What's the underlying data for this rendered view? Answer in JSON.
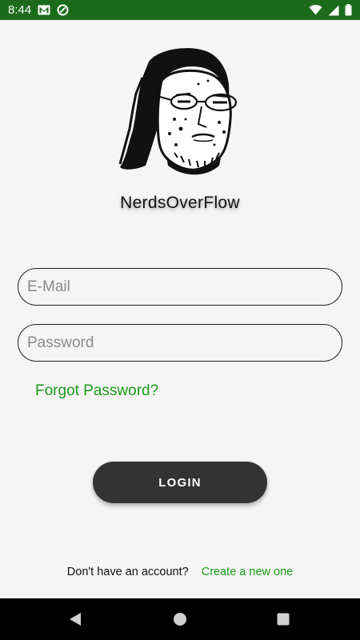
{
  "status_bar": {
    "time": "8:44",
    "icons": [
      "gmail-icon",
      "data-saver-icon",
      "wifi-icon",
      "signal-icon",
      "battery-icon"
    ]
  },
  "app": {
    "name": "NerdsOverFlow",
    "logo_icon": "nerd-face-logo"
  },
  "form": {
    "email_placeholder": "E-Mail",
    "email_value": "",
    "password_placeholder": "Password",
    "password_value": "",
    "forgot_label": "Forgot Password?",
    "login_label": "LOGIN"
  },
  "signup": {
    "prompt": "Don't have an account?",
    "link": "Create a new one"
  },
  "colors": {
    "status_bar": "#1b6b1b",
    "accent_green": "#1a9a1a",
    "button_bg": "#333333",
    "background": "#f5f5f5"
  },
  "nav_bar": {
    "icons": [
      "back-icon",
      "home-icon",
      "recents-icon"
    ]
  }
}
